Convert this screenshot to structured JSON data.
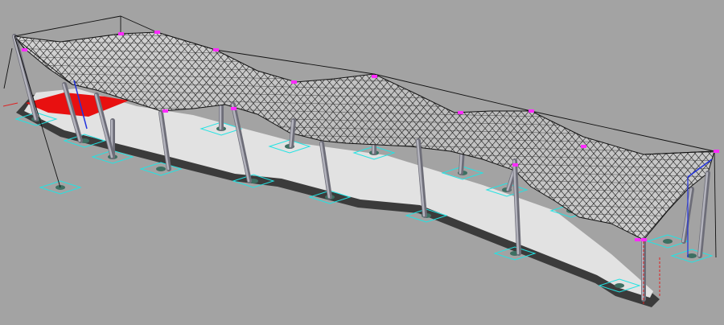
{
  "scene": {
    "subject": "tensile-membrane-canopy-3d-model",
    "colors": {
      "background": "#a3a3a3",
      "slab_top": "#e2e2e2",
      "slab_edge": "#3b3b3b",
      "membrane": "#c8c8c8",
      "mesh_line": "#1a1a1a",
      "column": "#9c9ca6",
      "column_shade": "#6d6d78",
      "footing_outline": "#23e3e3",
      "node_marker": "#ff2bff",
      "red_patch": "#e81010",
      "blue_axis": "#2233dd",
      "red_axis": "#dd2222"
    }
  }
}
